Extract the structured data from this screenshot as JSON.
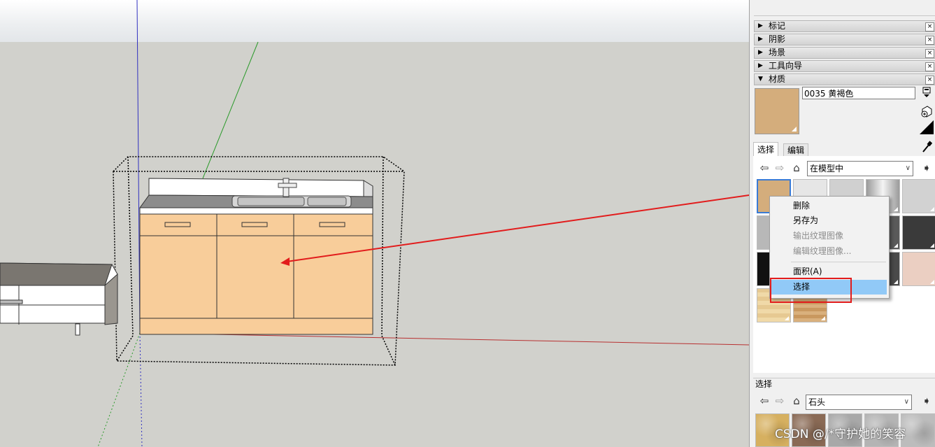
{
  "tray_sections": [
    {
      "label": "标记",
      "state": "collapsed"
    },
    {
      "label": "阴影",
      "state": "collapsed"
    },
    {
      "label": "场景",
      "state": "collapsed"
    },
    {
      "label": "工具向导",
      "state": "collapsed"
    },
    {
      "label": "材质",
      "state": "expanded"
    }
  ],
  "materials": {
    "current_name": "0035 黄褐色",
    "current_color": "#d4ad7c",
    "tabs": [
      "选择",
      "编辑"
    ],
    "library_select": "在模型中",
    "swatch_colors": [
      "#d4ad7c",
      "#e6e6e6",
      "#d0d0d0",
      "#b0b0b0",
      "#d2d2d2",
      "#b8b8b8",
      "",
      "",
      "#5a5a5a",
      "#3a3a3a",
      "#111111",
      "",
      "",
      "#4a4a4a",
      "#ebcfc2",
      "#ecd8b0",
      "#d8b98c"
    ]
  },
  "context_menu": {
    "items": [
      {
        "label": "删除",
        "enabled": true
      },
      {
        "label": "另存为",
        "enabled": true
      },
      {
        "label": "输出纹理图像",
        "enabled": false
      },
      {
        "label": "编辑纹理图像...",
        "enabled": false
      },
      {
        "label": "面积(A)",
        "enabled": true
      },
      {
        "label": "选择",
        "enabled": true,
        "highlighted": true
      }
    ]
  },
  "lower_browser": {
    "title": "选择",
    "library_select": "石头",
    "swatch_colors": [
      "#d6b060",
      "#8a6a55",
      "#a8a8a8",
      "#b4b4b4",
      "#bcbcbc"
    ]
  },
  "icons": [
    "back-arrow-icon",
    "forward-arrow-icon",
    "home-icon",
    "details-arrow-icon",
    "eyedropper-icon",
    "create-material-icon",
    "paint-bucket-icon",
    "close-icon"
  ],
  "watermark": "CSDN @/*守护她的笑容",
  "colors": {
    "annotation_red": "#e21c1c",
    "menu_highlight": "#91c9f7",
    "cabinet_fill": "#f8cd9a"
  }
}
